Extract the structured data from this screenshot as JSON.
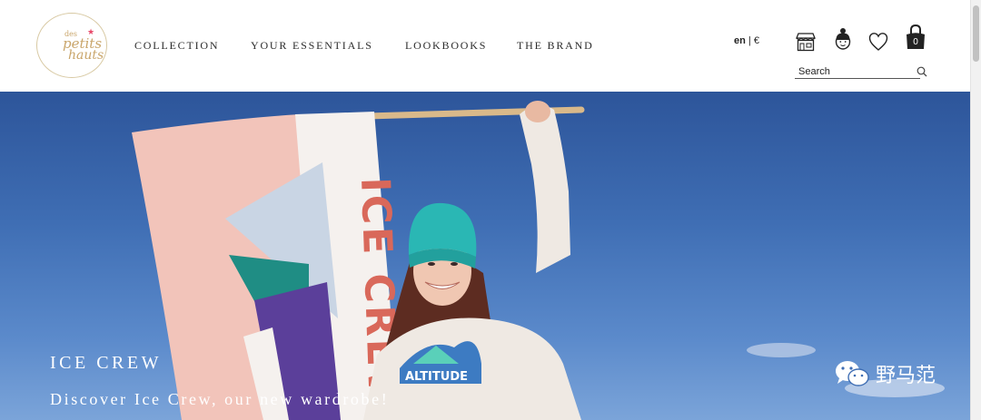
{
  "logo": {
    "line1": "des",
    "line2": "petits",
    "line3": "hauts"
  },
  "nav": [
    {
      "label": "COLLECTION"
    },
    {
      "label": "YOUR ESSENTIALS"
    },
    {
      "label": "LOOKBOOKS"
    },
    {
      "label": "THE BRAND"
    }
  ],
  "header": {
    "lang": "en",
    "currency": "€",
    "separator": " | ",
    "cart_count": "0",
    "icons": [
      "store-icon",
      "account-icon",
      "wishlist-heart-icon",
      "cart-bag-icon",
      "search-icon"
    ]
  },
  "search": {
    "placeholder": "Search",
    "value": ""
  },
  "hero": {
    "title": "ICE CREW",
    "subtitle": "Discover Ice Crew, our new wardrobe!",
    "flag_text": "ICE CREW",
    "sweater_text": "ALTITUDE"
  },
  "watermark": {
    "text": "野马范"
  },
  "colors": {
    "sky": "#3f6eb4",
    "logo_gold": "#c9a56a",
    "text": "#2c2c2c"
  }
}
